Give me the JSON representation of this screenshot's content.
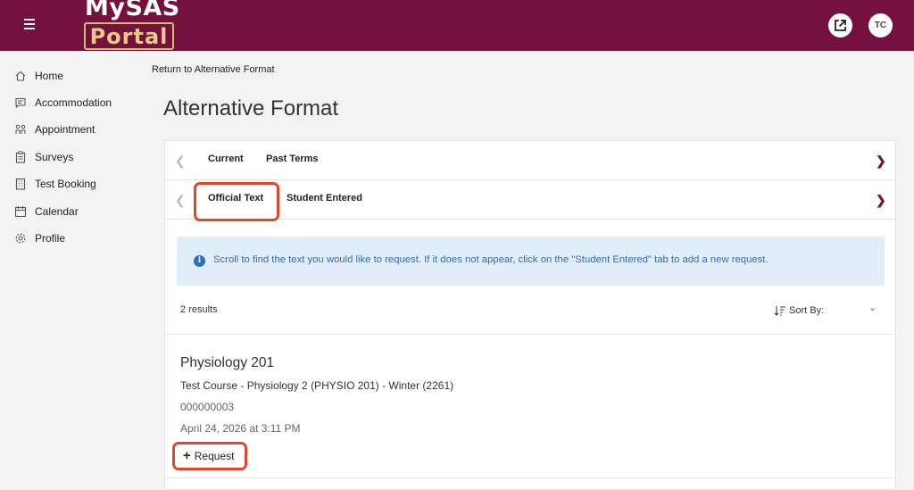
{
  "header": {
    "logo_top": "MySAS",
    "logo_bottom": "Portal",
    "avatar_initials": "TC",
    "brand_color": "#74113f"
  },
  "sidebar": {
    "items": [
      {
        "label": "Home",
        "icon": "home-icon"
      },
      {
        "label": "Accommodation",
        "icon": "chat-icon"
      },
      {
        "label": "Appointment",
        "icon": "people-icon"
      },
      {
        "label": "Surveys",
        "icon": "clipboard-icon"
      },
      {
        "label": "Test Booking",
        "icon": "building-icon"
      },
      {
        "label": "Calendar",
        "icon": "calendar-icon"
      },
      {
        "label": "Profile",
        "icon": "gear-icon"
      }
    ]
  },
  "main": {
    "back_link": "Return to Alternative Format",
    "title": "Alternative Format",
    "term_tabs": [
      "Current",
      "Past Terms"
    ],
    "type_tabs": [
      "Official Text",
      "Student Entered"
    ],
    "info_text": "Scroll to find the text you would like to request. If it does not appear, click on the \"Student Entered\" tab to add a new request.",
    "results_count": "2 results",
    "sort_label": "Sort By:",
    "item": {
      "title": "Physiology 201",
      "course": "Test Course - Physiology 2 (PHYSIO 201) - Winter (2261)",
      "id": "000000003",
      "date": "April 24, 2026 at 3:11 PM",
      "request_label": "Request"
    },
    "highlight_color": "#e2472c",
    "info_color": "#2e6fb7"
  }
}
